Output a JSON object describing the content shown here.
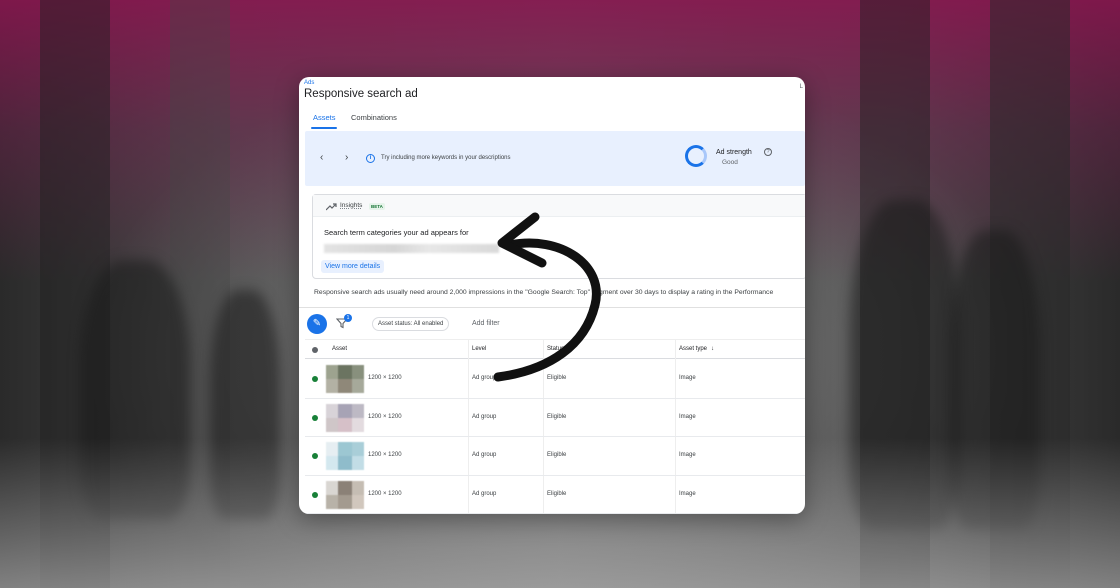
{
  "breadcrumb": "Ads",
  "corner_text": "L",
  "page_title": "Responsive search ad",
  "tabs": [
    {
      "label": "Assets",
      "active": true
    },
    {
      "label": "Combinations",
      "active": false
    }
  ],
  "strength_panel": {
    "tip": "Try including more keywords in your descriptions",
    "ad_strength_label": "Ad strength",
    "ad_strength_value": "Good"
  },
  "insights": {
    "label": "Insights",
    "badge": "BETA",
    "heading": "Search term categories your ad appears for",
    "button": "View more details"
  },
  "notice": "Responsive search ads usually need around 2,000 impressions in the \"Google Search: Top\" segment over 30 days to display a rating in the Performance",
  "toolbar": {
    "filter_count": "1",
    "status_chip": "Asset status: All enabled",
    "add_filter": "Add filter"
  },
  "table": {
    "columns": [
      "Asset",
      "Level",
      "Status",
      "Asset type"
    ],
    "rows": [
      {
        "size": "1200 × 1200",
        "level": "Ad group",
        "status": "Eligible",
        "type": "Image"
      },
      {
        "size": "1200 × 1200",
        "level": "Ad group",
        "status": "Eligible",
        "type": "Image"
      },
      {
        "size": "1200 × 1200",
        "level": "Ad group",
        "status": "Eligible",
        "type": "Image"
      },
      {
        "size": "1200 × 1200",
        "level": "Ad group",
        "status": "Eligible",
        "type": "Image"
      }
    ]
  },
  "colors": {
    "accent": "#1a73e8",
    "status_green": "#188038",
    "banner_bg": "#e8f0fe",
    "bg_magenta": "#8c1450"
  }
}
